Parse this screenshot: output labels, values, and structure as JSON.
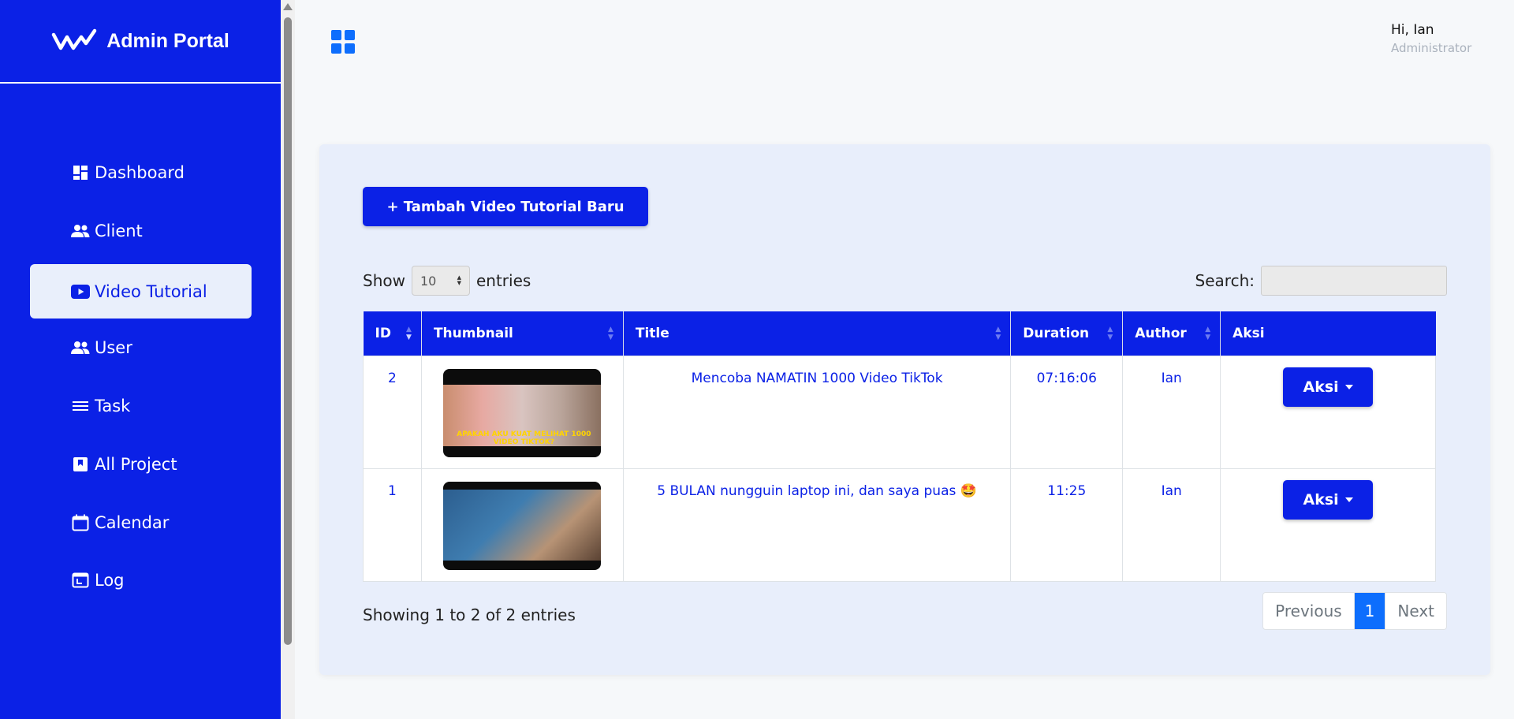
{
  "brand": {
    "title": "Admin Portal",
    "logo_icon": "wave-check-logo-icon"
  },
  "sidebar": {
    "items": [
      {
        "label": "Dashboard",
        "icon": "dashboard-icon",
        "active": false
      },
      {
        "label": "Client",
        "icon": "users-icon",
        "active": false
      },
      {
        "label": "Video Tutorial",
        "icon": "youtube-icon",
        "active": true
      },
      {
        "label": "User",
        "icon": "users-icon",
        "active": false
      },
      {
        "label": "Task",
        "icon": "lines-icon",
        "active": false
      },
      {
        "label": "All Project",
        "icon": "bookmark-icon",
        "active": false
      },
      {
        "label": "Calendar",
        "icon": "calendar-icon",
        "active": false
      },
      {
        "label": "Log",
        "icon": "log-icon",
        "active": false
      }
    ]
  },
  "header": {
    "greeting": "Hi, Ian",
    "role": "Administrator"
  },
  "main": {
    "add_button": "+ Tambah Video Tutorial Baru",
    "show_label": "Show",
    "entries_label": "entries",
    "page_length": "10",
    "search_label": "Search:",
    "search_value": "",
    "columns": [
      "ID",
      "Thumbnail",
      "Title",
      "Duration",
      "Author",
      "Aksi"
    ],
    "rows": [
      {
        "id": "2",
        "title": "Mencoba NAMATIN 1000 Video TikTok",
        "duration": "07:16:06",
        "author": "Ian",
        "action": "Aksi",
        "thumb_caption": "APAKAH AKU KUAT MELIHAT 1000 VIDEO TIKTOK?"
      },
      {
        "id": "1",
        "title": "5 BULAN nungguin laptop ini, dan saya puas 🤩",
        "duration": "11:25",
        "author": "Ian",
        "action": "Aksi"
      }
    ],
    "info": "Showing 1 to 2 of 2 entries",
    "pagination": {
      "previous": "Previous",
      "current": "1",
      "next": "Next"
    }
  },
  "colors": {
    "primary": "#0b21e6",
    "accent": "#0d6efd",
    "card_bg": "#e8eefb"
  }
}
